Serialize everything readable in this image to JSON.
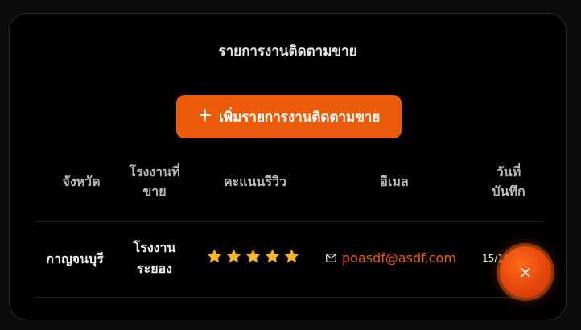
{
  "page": {
    "title": "รายการงานติดตามขาย"
  },
  "toolbar": {
    "add_label": "เพิ่มรายการงานติดตามขาย",
    "add_icon": "plus-icon"
  },
  "table": {
    "headers": {
      "province": "จังหวัด",
      "factory_line1": "โรงงานที่",
      "factory_line2": "ขาย",
      "rating": "คะแนนรีวิว",
      "email": "อีเมล",
      "date_line1": "วันที่",
      "date_line2": "บันทึก"
    },
    "rows": [
      {
        "province": "กาญจนบุรี",
        "factory_line1": "โรงงาน",
        "factory_line2": "ระยอง",
        "rating": 5,
        "rating_max": 5,
        "email": "poasdf@asdf.com",
        "date": "15/10/20"
      }
    ]
  },
  "fab": {
    "label": "×",
    "icon": "close-icon"
  },
  "colors": {
    "accent": "#ea5b0c",
    "star": "#f5b82e",
    "background": "#000000"
  }
}
